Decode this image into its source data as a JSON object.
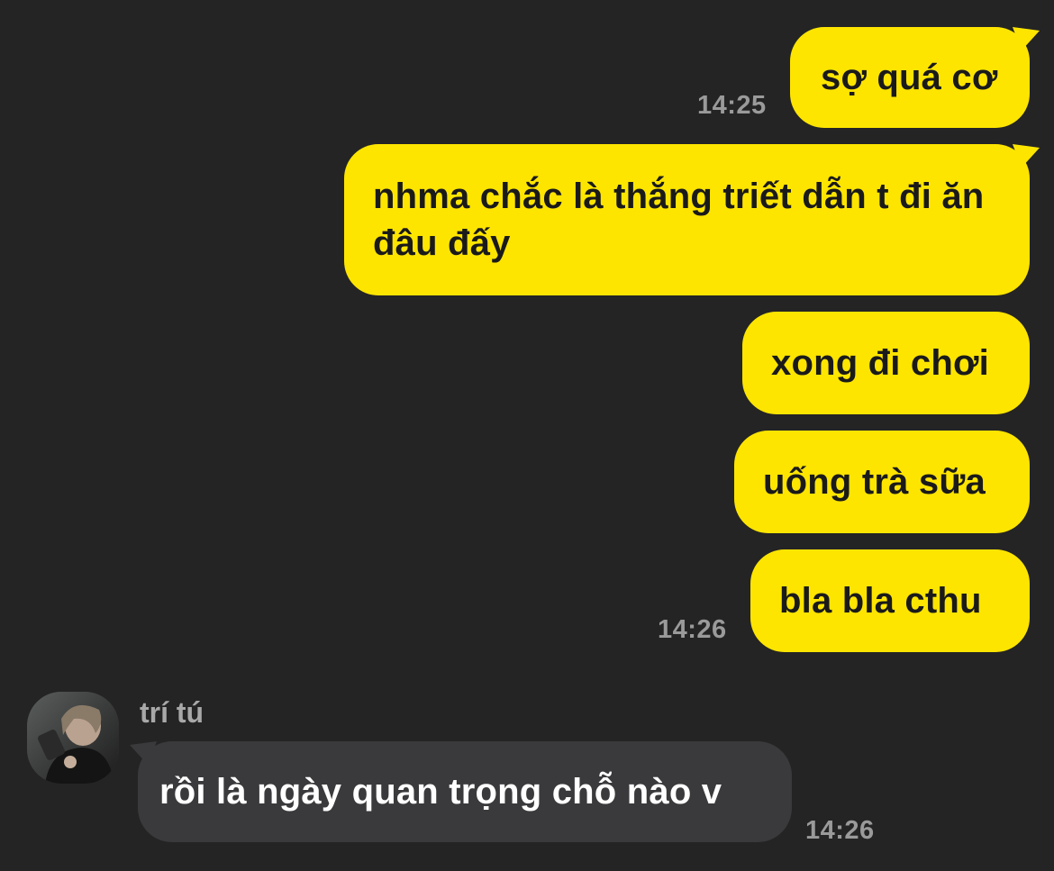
{
  "messages": {
    "outgoing": [
      {
        "text": "sợ quá cơ",
        "time": "14:25"
      },
      {
        "text": "nhma chắc là thắng triết dẫn t đi ăn đâu đấy"
      },
      {
        "text": "xong đi chơi"
      },
      {
        "text": "uống trà sữa"
      },
      {
        "text": "bla bla cthu",
        "time": "14:26"
      }
    ],
    "incoming": [
      {
        "sender": "trí tú",
        "text": "rồi là ngày quan trọng chỗ nào v",
        "time": "14:26",
        "avatar_icon": "user-avatar-photo"
      }
    ]
  },
  "colors": {
    "background": "#242424",
    "outgoing_bubble": "#fee500",
    "incoming_bubble": "#3a3a3c",
    "timestamp": "#9a9a9a"
  }
}
